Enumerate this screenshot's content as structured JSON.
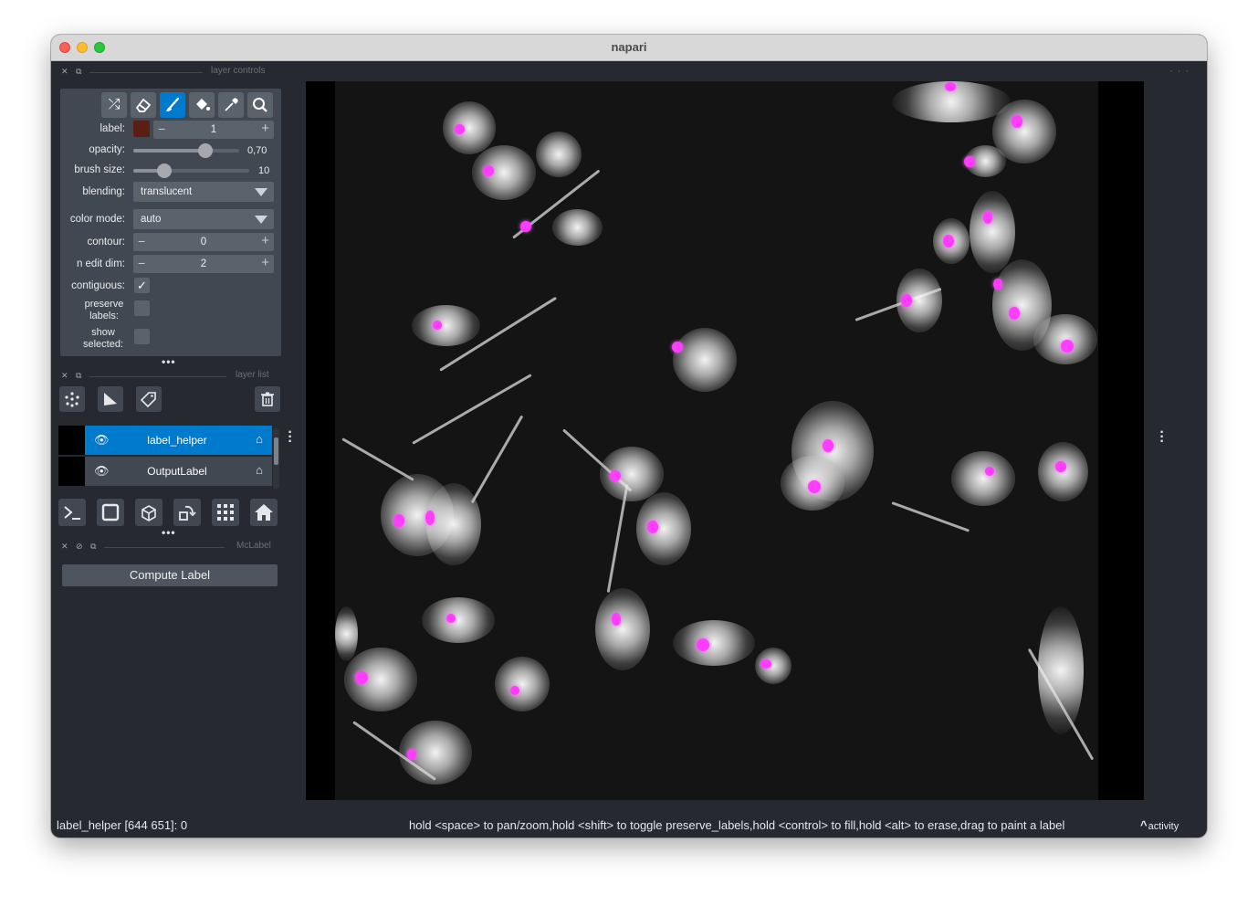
{
  "window": {
    "title": "napari"
  },
  "docks": {
    "layer_controls": "layer controls",
    "layer_list": "layer list",
    "plugin": "McLabel"
  },
  "controls": {
    "label": {
      "name": "label:",
      "value": "1",
      "swatch_color": "#5a1e14"
    },
    "opacity": {
      "name": "opacity:",
      "value": "0,70",
      "fraction": 0.7
    },
    "brush_size": {
      "name": "brush size:",
      "value": "10",
      "fraction": 0.2
    },
    "blending": {
      "name": "blending:",
      "value": "translucent"
    },
    "color_mode": {
      "name": "color mode:",
      "value": "auto"
    },
    "contour": {
      "name": "contour:",
      "value": "0"
    },
    "n_edit_dim": {
      "name": "n edit dim:",
      "value": "2"
    },
    "contiguous": {
      "name": "contiguous:",
      "checked": true
    },
    "preserve_labels": {
      "name": "preserve labels:",
      "checked": false
    },
    "show_selected": {
      "name": "show selected:",
      "checked": false
    }
  },
  "layers": [
    {
      "name": "label_helper",
      "selected": true
    },
    {
      "name": "OutputLabel",
      "selected": false
    }
  ],
  "plugin": {
    "compute_label": "Compute Label"
  },
  "status": {
    "left": "label_helper [644 651]: 0",
    "hint": "hold <space> to pan/zoom,hold <shift> to toggle preserve_labels,hold <control> to fill,hold <alt> to erase,drag to paint a label",
    "activity": "activity"
  },
  "colors": {
    "accent": "#007acc",
    "nucleus": "#ff3dff",
    "background": "#262930",
    "panel": "#414851"
  },
  "icons": [
    "shuffle-icon",
    "eraser-icon",
    "paintbrush-icon",
    "fill-bucket-icon",
    "color-picker-icon",
    "zoom-icon",
    "points-icon",
    "shapes-icon",
    "labels-icon",
    "trash-icon",
    "eye-icon",
    "tag-icon",
    "console-icon",
    "square-icon",
    "cube-icon",
    "rotate-icon",
    "grid-icon",
    "home-icon"
  ]
}
